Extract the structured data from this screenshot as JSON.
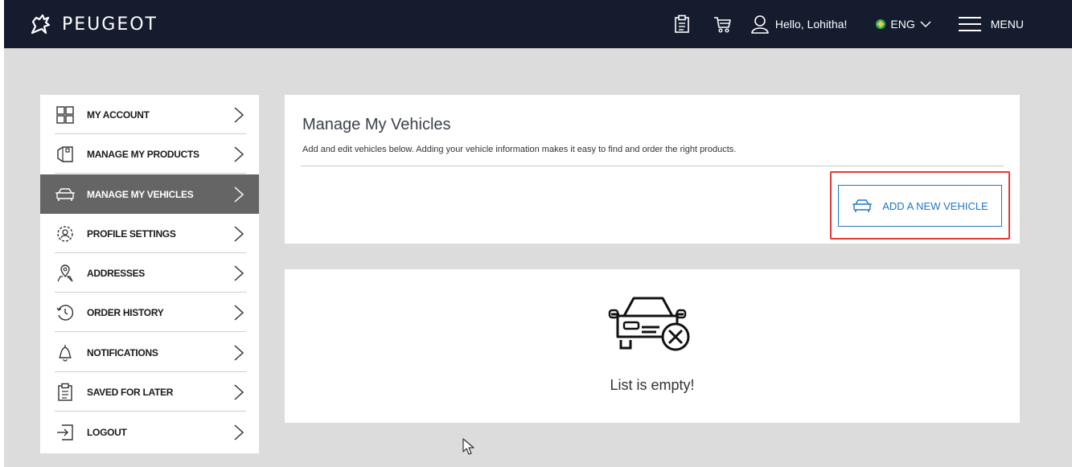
{
  "header": {
    "brand": "PEUGEOT",
    "greeting": "Hello, Lohitha!",
    "language": "ENG",
    "menu_label": "MENU",
    "bg_color": "#141c2e"
  },
  "sidebar": {
    "active_color": "#656565",
    "items": [
      {
        "label": "MY ACCOUNT",
        "icon": "grid-icon"
      },
      {
        "label": "MANAGE MY PRODUCTS",
        "icon": "box-icon"
      },
      {
        "label": "MANAGE MY VEHICLES",
        "icon": "car-icon",
        "active": true
      },
      {
        "label": "PROFILE SETTINGS",
        "icon": "gear-user-icon"
      },
      {
        "label": "ADDRESSES",
        "icon": "map-pin-icon"
      },
      {
        "label": "ORDER HISTORY",
        "icon": "history-icon"
      },
      {
        "label": "NOTIFICATIONS",
        "icon": "bell-icon"
      },
      {
        "label": "SAVED FOR LATER",
        "icon": "clipboard-icon"
      },
      {
        "label": "LOGOUT",
        "icon": "logout-icon"
      }
    ]
  },
  "main": {
    "title": "Manage My Vehicles",
    "description": "Add and edit vehicles below. Adding your vehicle information makes it easy to find and order the right products.",
    "add_button": "ADD A NEW VEHICLE",
    "accent_color": "#1e78c8",
    "highlight_color": "#e53935",
    "empty_text": "List is empty!"
  }
}
